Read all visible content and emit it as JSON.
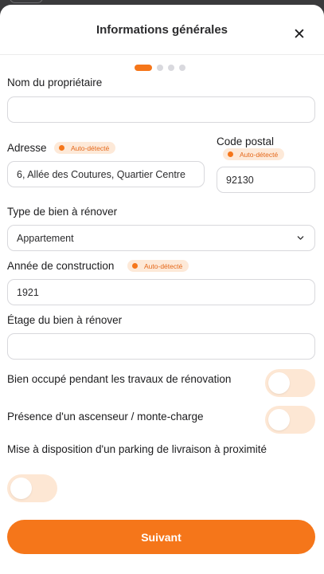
{
  "header": {
    "title": "Informations générales",
    "close_glyph": "✕"
  },
  "stepper": {
    "total_steps": 4,
    "current_step": 1
  },
  "badge_text": "Auto-détecté",
  "form": {
    "owner_name": {
      "label": "Nom du propriétaire",
      "value": ""
    },
    "address": {
      "label": "Adresse",
      "value": "6, Allée des Coutures, Quartier Centre",
      "auto_detected": true
    },
    "postal_code": {
      "label": "Code postal",
      "value": "92130",
      "auto_detected": true
    },
    "property_type": {
      "label": "Type de bien à rénover",
      "value": "Appartement"
    },
    "construction_year": {
      "label": "Année de construction",
      "value": "1921",
      "auto_detected": true
    },
    "floor": {
      "label": "Étage du bien à rénover",
      "value": ""
    },
    "occupied_during_works": {
      "label": "Bien occupé pendant les travaux de rénovation",
      "checked": false
    },
    "elevator": {
      "label": "Présence d'un ascenseur / monte-charge",
      "checked": false
    },
    "delivery_parking": {
      "label": "Mise à disposition d'un parking de livraison à proximité",
      "checked": false
    }
  },
  "next_button": {
    "label": "Suivant"
  },
  "colors": {
    "accent": "#f5761a",
    "accent_soft": "#fde7d4",
    "badge_text": "#e4681a",
    "border": "#d8d8dc"
  }
}
